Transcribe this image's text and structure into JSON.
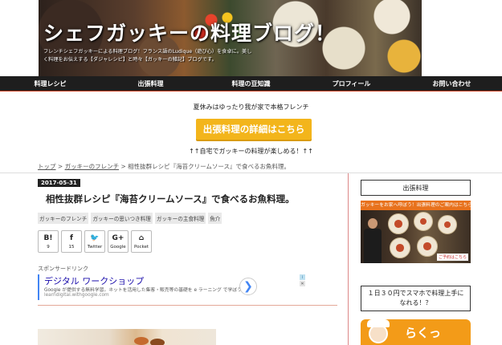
{
  "header": {
    "title": "シェフガッキーの料理ブログ！",
    "description": "フレンチシェフガッキーによる料理ブログ！フランス語のLudique（遊び心）を食卓に。美しく料理をお伝えする【ダジャレシピ】と時々【ガッキーの雑記】ブログです。"
  },
  "nav": {
    "items": [
      "料理レシピ",
      "出張料理",
      "料理の豆知識",
      "プロフィール",
      "お問い合わせ"
    ]
  },
  "promo": {
    "top_text": "夏休みはゆったり我が家で本格フレンチ",
    "button_label": "出張料理の詳細はこちら",
    "bottom_text": "↑↑自宅でガッキーの料理が楽しめる！↑↑"
  },
  "breadcrumb": {
    "items": [
      "トップ",
      "ガッキーのフレンチ",
      "相性抜群レシピ『海苔クリームソース』で食べるお魚料理。"
    ],
    "separator": ">"
  },
  "post": {
    "date": "2017-05-31",
    "title": "相性抜群レシピ『海苔クリームソース』で食べるお魚料理。",
    "tags": [
      "ガッキーのフレンチ",
      "ガッキーの思いつき料理",
      "ガッキーの主食料理",
      "魚介"
    ]
  },
  "share": [
    {
      "icon": "B!",
      "name": "hatena-icon",
      "count": "9"
    },
    {
      "icon": "f",
      "name": "facebook-icon",
      "count": "15"
    },
    {
      "icon": "🐦",
      "name": "twitter-icon",
      "count": "Twitter"
    },
    {
      "icon": "G+",
      "name": "google-plus-icon",
      "count": "Google"
    },
    {
      "icon": "⌂",
      "name": "pocket-icon",
      "count": "Pocket"
    }
  ],
  "ad": {
    "label": "スポンサードリンク",
    "title": "デジタル ワークショップ",
    "description": "Google が提供する無料学習。ネットを活用した集客・販売等の基礎を e ラーニング で学ぼう",
    "url": "learndigital.withgoogle.com",
    "arrow": "❯",
    "info": "i",
    "close": "✕"
  },
  "sidebar": {
    "widget1_title": "出張料理",
    "banner_top": "ガッキーをお家へ呼ぼう！出張料理のご案内はこちら！",
    "banner_badge": "ご予約はこちら",
    "widget2_title": "１日３０円でスマホで料理上手になれる！？",
    "rakuten_text": "らくっ"
  },
  "colors": {
    "nav_bg": "#1e1e1e",
    "accent": "#f3b51b",
    "link": "#1a0dab"
  }
}
